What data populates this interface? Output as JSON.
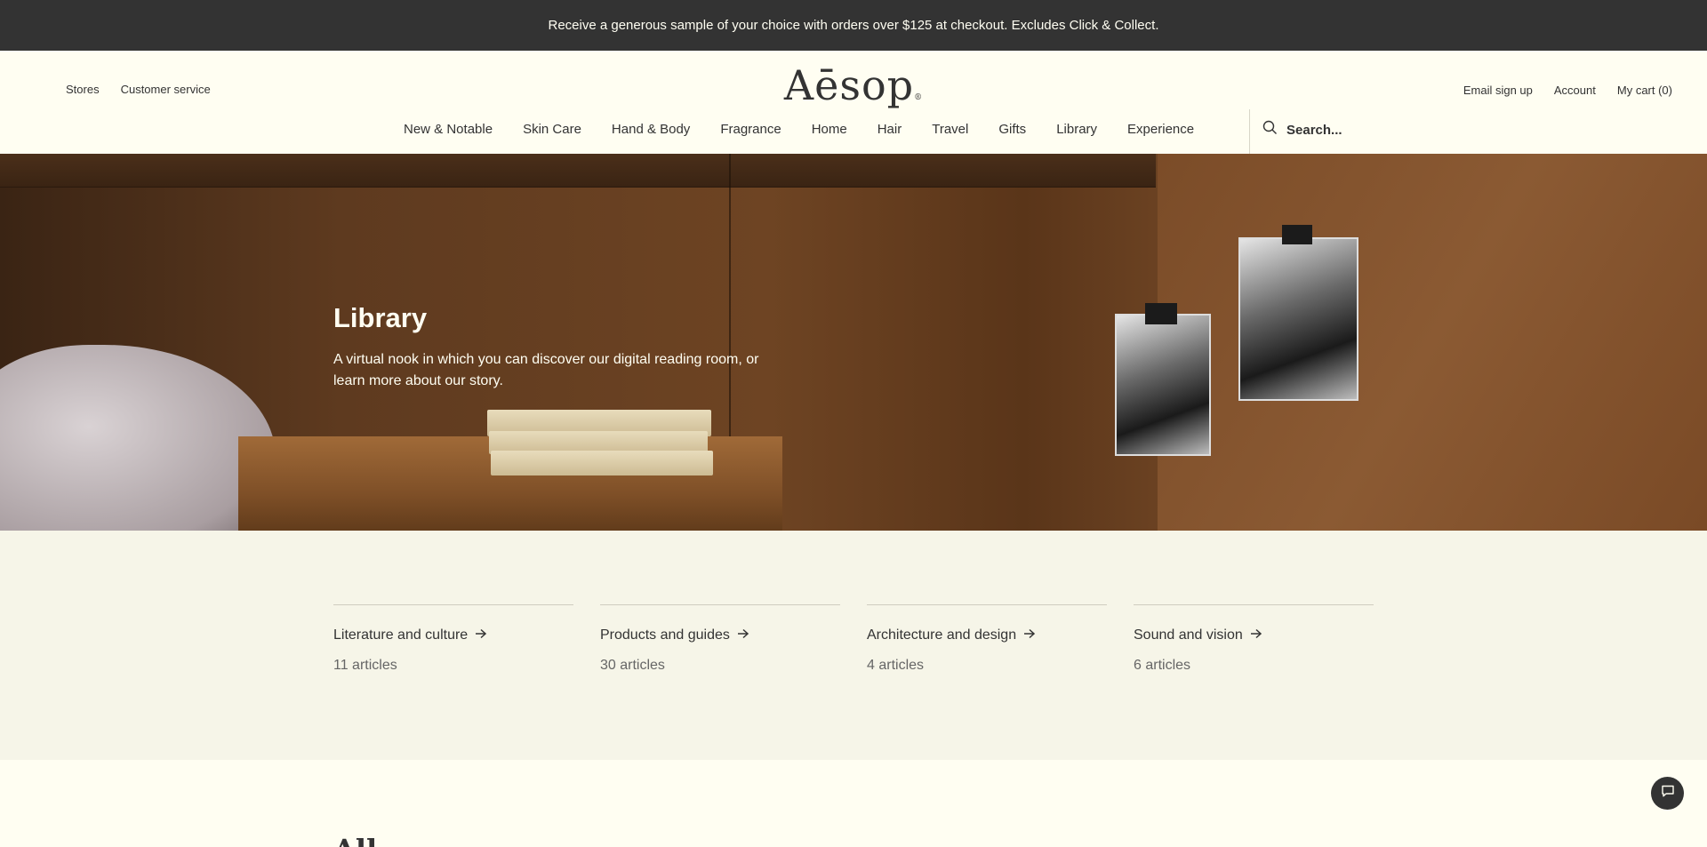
{
  "promo": {
    "text": "Receive a generous sample of your choice with orders over $125 at checkout. Excludes Click & Collect."
  },
  "header": {
    "logo": "Aēsop",
    "logo_mark": "®",
    "utility_left": [
      "Stores",
      "Customer service"
    ],
    "utility_right": [
      "Email sign up",
      "Account",
      "My cart (0)"
    ]
  },
  "nav": {
    "items": [
      "New & Notable",
      "Skin Care",
      "Hand & Body",
      "Fragrance",
      "Home",
      "Hair",
      "Travel",
      "Gifts",
      "Library",
      "Experience"
    ],
    "search_placeholder": "Search..."
  },
  "hero": {
    "title": "Library",
    "description": "A virtual nook in which you can discover our digital reading room, or learn more about our story."
  },
  "categories": [
    {
      "title": "Literature and culture",
      "count": "11 articles"
    },
    {
      "title": "Products and guides",
      "count": "30 articles"
    },
    {
      "title": "Architecture and design",
      "count": "4 articles"
    },
    {
      "title": "Sound and vision",
      "count": "6 articles"
    }
  ],
  "lower": {
    "heading_partial": "All"
  },
  "icons": {
    "search": "search-icon",
    "arrow": "arrow-right-icon",
    "chat": "chat-icon"
  },
  "colors": {
    "promo_bg": "#333333",
    "page_bg": "#fffef2",
    "categories_bg": "#f6f5e8"
  }
}
